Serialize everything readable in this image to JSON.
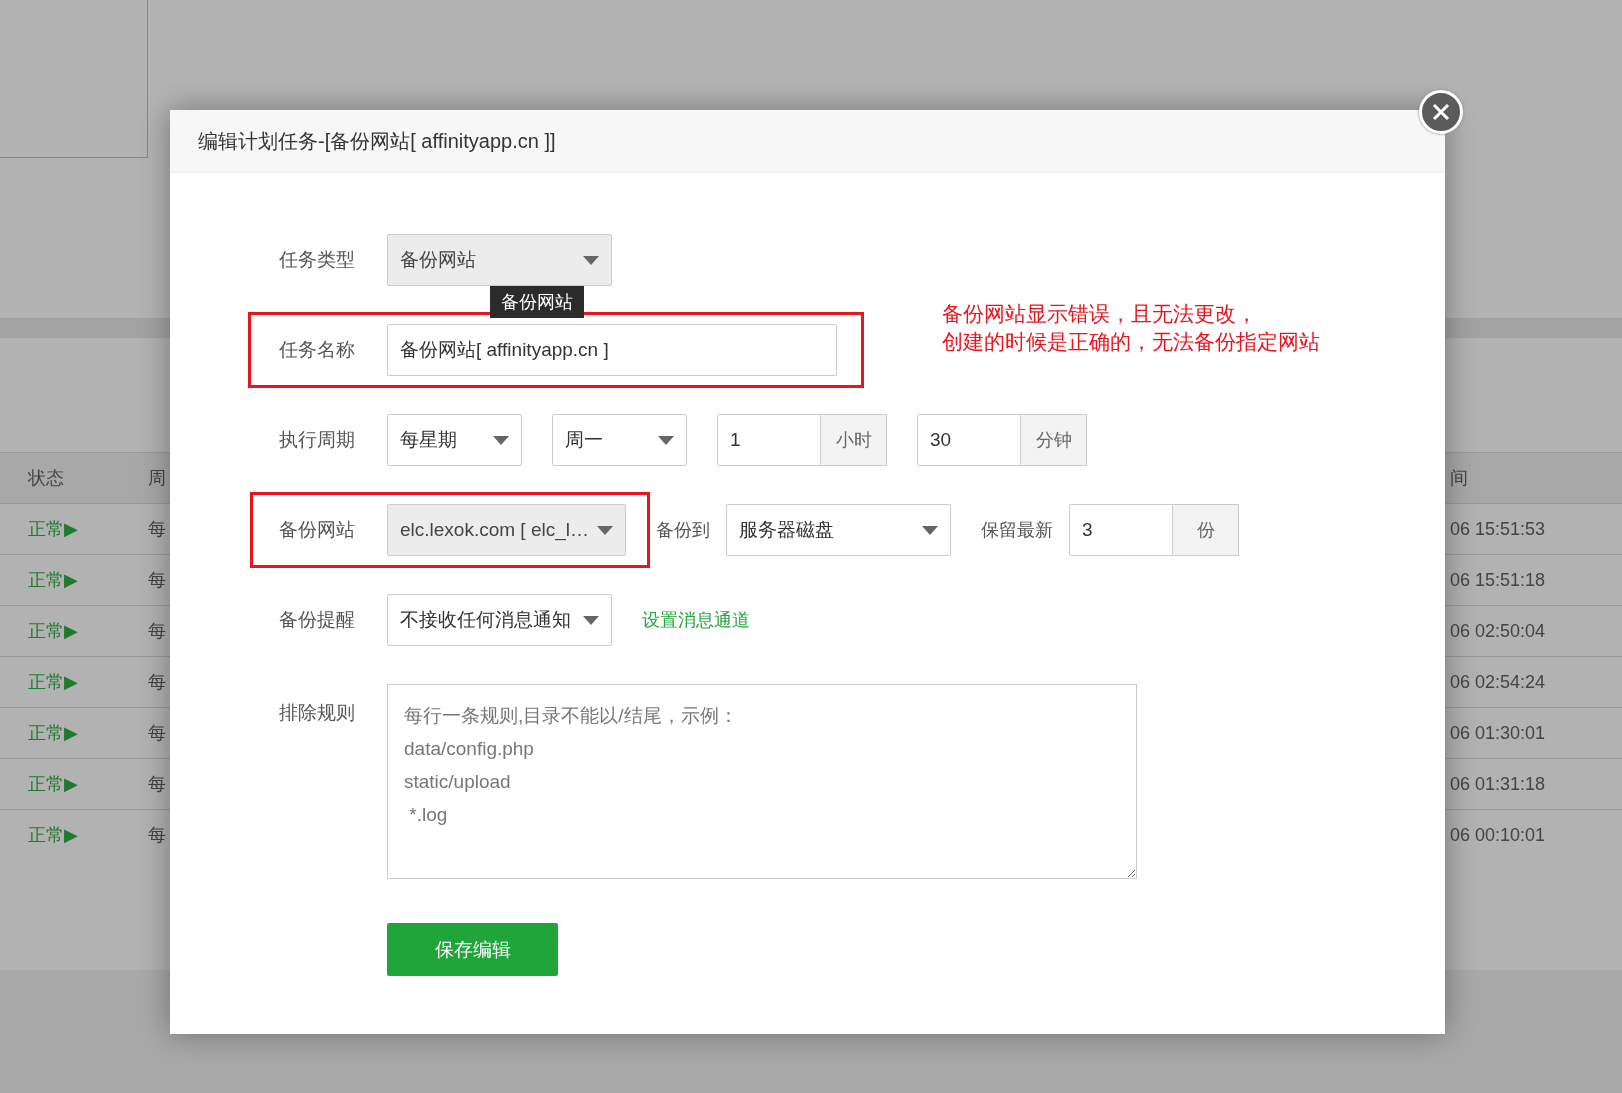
{
  "background": {
    "columns": [
      "状态",
      "周",
      "间"
    ],
    "rows": [
      {
        "status": "正常▶",
        "period": "每",
        "time": "06 15:51:53"
      },
      {
        "status": "正常▶",
        "period": "每",
        "time": "06 15:51:18"
      },
      {
        "status": "正常▶",
        "period": "每",
        "time": "06 02:50:04"
      },
      {
        "status": "正常▶",
        "period": "每",
        "time": "06 02:54:24"
      },
      {
        "status": "正常▶",
        "period": "每",
        "time": "06 01:30:01"
      },
      {
        "status": "正常▶",
        "period": "每",
        "time": "06 01:31:18"
      },
      {
        "status": "正常▶",
        "period": "每",
        "time": "06 00:10:01"
      }
    ]
  },
  "dialog": {
    "title": "编辑计划任务-[备份网站[ affinityapp.cn ]]",
    "form": [
      {
        "label": "任务类型",
        "highlighted": false,
        "fields": [
          {
            "kind": "select",
            "value": "备份网站",
            "disabled": true
          }
        ],
        "tooltip": "备份网站"
      },
      {
        "label": "任务名称",
        "highlighted": true,
        "fields": [
          {
            "kind": "input",
            "value": "备份网站[ affinityapp.cn ]"
          }
        ]
      },
      {
        "label": "执行周期",
        "highlighted": false,
        "fields": [
          {
            "kind": "select",
            "value": "每星期",
            "disabled": false
          },
          {
            "kind": "select",
            "value": "周一",
            "disabled": false
          },
          {
            "kind": "addon",
            "value": "1",
            "unit": "小时"
          },
          {
            "kind": "addon",
            "value": "30",
            "unit": "分钟"
          }
        ]
      },
      {
        "label": "备份网站",
        "highlighted": true,
        "fields": [
          {
            "kind": "select",
            "value": "elc.lexok.com [ elc_l…",
            "disabled": true
          },
          {
            "kind": "text",
            "value": "备份到"
          },
          {
            "kind": "select",
            "value": "服务器磁盘",
            "disabled": false
          },
          {
            "kind": "text",
            "value": "保留最新"
          },
          {
            "kind": "addon",
            "value": "3",
            "unit": "份"
          }
        ]
      },
      {
        "label": "备份提醒",
        "highlighted": false,
        "fields": [
          {
            "kind": "select",
            "value": "不接收任何消息通知",
            "disabled": false
          },
          {
            "kind": "link",
            "value": "设置消息通道"
          }
        ]
      },
      {
        "label": "排除规则",
        "highlighted": false,
        "fields": [
          {
            "kind": "textarea",
            "placeholder": "每行一条规则,目录不能以/结尾，示例：\ndata/config.php\nstatic/upload\n *.log"
          }
        ]
      }
    ],
    "save_button": "保存编辑"
  },
  "annotation": [
    "备份网站显示错误，且无法更改，",
    "创建的时候是正确的，无法备份指定网站"
  ]
}
